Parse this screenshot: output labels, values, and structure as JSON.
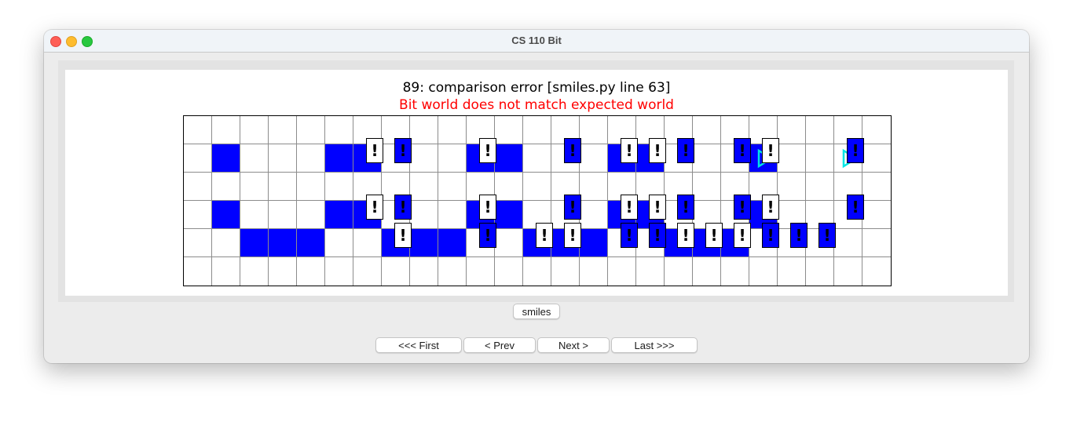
{
  "window": {
    "title": "CS 110 Bit"
  },
  "messages": {
    "status": "89: comparison error  [smiles.py line 63]",
    "error": "Bit world does not match expected world"
  },
  "colors": {
    "filled": "#0000ff",
    "error_text": "#ff0000",
    "bit": "#00e5e5"
  },
  "world": {
    "cols": 25,
    "rows": 6,
    "blue_cells": [
      {
        "row": 1,
        "cols": [
          1,
          5,
          6,
          10,
          11,
          15,
          16,
          20
        ]
      },
      {
        "row": 3,
        "cols": [
          1,
          5,
          6,
          10,
          11,
          15,
          16,
          20
        ]
      },
      {
        "row": 4,
        "cols": [
          2,
          3,
          4,
          7,
          8,
          9,
          12,
          13,
          14,
          17,
          18,
          19
        ]
      }
    ],
    "mismatch_markers": [
      {
        "row": 1,
        "white": [
          6,
          10,
          15,
          16,
          20
        ],
        "blue": [
          7,
          13,
          17,
          19,
          23
        ]
      },
      {
        "row": 3,
        "white": [
          6,
          10,
          15,
          16,
          20
        ],
        "blue": [
          7,
          13,
          17,
          19,
          23
        ]
      },
      {
        "row": 4,
        "white": [
          7,
          12,
          13,
          17,
          18,
          19
        ],
        "blue": [
          10,
          15,
          16,
          20,
          21,
          22
        ]
      }
    ],
    "marker_symbol": "!",
    "bits": [
      {
        "row": 1,
        "col": 20,
        "direction": "right"
      },
      {
        "row": 1,
        "col": 23,
        "direction": "right"
      }
    ]
  },
  "buttons": {
    "case": "smiles",
    "first": "<<< First",
    "prev": "< Prev",
    "next": "Next >",
    "last": "Last >>>"
  }
}
